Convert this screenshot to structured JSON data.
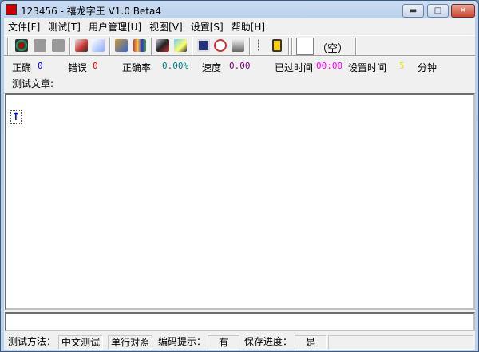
{
  "window": {
    "title": "123456 - 禧龙字王 V1.0 Beta4",
    "minimize": "▬",
    "maximize": "□",
    "close": "✕"
  },
  "menu": [
    "文件[F]",
    "测试[T]",
    "用户管理[U]",
    "视图[V]",
    "设置[S]",
    "帮助[H]"
  ],
  "toolbar": {
    "empty_label": "（空）"
  },
  "stats": {
    "correct_label": "正确",
    "correct": "0",
    "wrong_label": "错误",
    "wrong": "0",
    "rate_label": "正确率",
    "rate": "0.00%",
    "speed_label": "速度",
    "speed": "0.00",
    "elapsed_label": "已过时间",
    "elapsed": "00:00",
    "set_time_label": "设置时间",
    "set_time": "5",
    "minutes": "分钟"
  },
  "article_label": "测试文章:",
  "cursor_glyph": "↑",
  "statusbar": {
    "method_label": "测试方法：",
    "method": "中文测试",
    "mode": "单行对照",
    "hint_label": "编码提示：",
    "hint": "有",
    "save_label": "保存进度：",
    "save": "是"
  },
  "colors": {
    "correct": "#0000ff",
    "wrong": "#ff0000",
    "rate": "#008080",
    "speed": "#800080",
    "elapsed": "#ff00ff",
    "set_time": "#ffff00"
  }
}
